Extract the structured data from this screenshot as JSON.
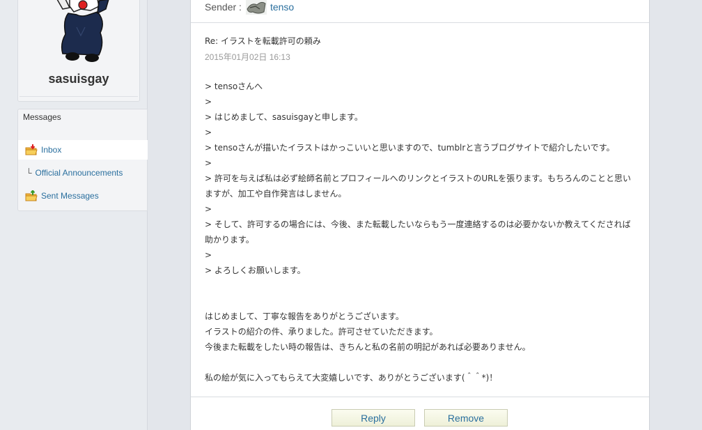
{
  "profile": {
    "username": "sasuisgay"
  },
  "sidebar": {
    "title": "Messages",
    "items": [
      {
        "label": "Inbox",
        "icon": "inbox-folder-icon",
        "active": true
      },
      {
        "label": "Official Announcements",
        "icon": "sub-item-marker",
        "active": false
      },
      {
        "label": "Sent Messages",
        "icon": "sent-folder-icon",
        "active": false
      }
    ]
  },
  "message": {
    "sender_label": "Sender :",
    "sender_name": "tenso",
    "subject": "Re: イラストを転載許可の頼み",
    "date": "2015年01月02日 16:13",
    "body_lines": [
      "> tensoさんへ",
      ">",
      "> はじめまして、sasuisgayと申します。",
      ">",
      "> tensoさんが描いたイラストはかっこいいと思いますので、tumblrと言うブログサイトで紹介したいです。",
      ">",
      "> 許可を与えば私は必ず絵師名前とプロフィールへのリンクとイラストのURLを張ります。もちろんのことと思い",
      "ますが、加工や自作発言はしません。",
      ">",
      "> そして、許可するの場合には、今後、また転載したいならもう一度連絡するのは必要かないか教えてくだされば",
      "助かります。",
      ">",
      "> よろしくお願いします。",
      "",
      "",
      "はじめまして、丁寧な報告をありがとうございます。",
      "イラストの紹介の件、承りました。許可させていただきます。",
      "今後また転載をしたい時の報告は、きちんと私の名前の明記があれば必要ありません。",
      "",
      "私の絵が気に入ってもらえて大変嬉しいです、ありがとうございます(＾＾*)！"
    ]
  },
  "actions": {
    "reply_label": "Reply",
    "remove_label": "Remove"
  },
  "colors": {
    "link": "#2a6f9e",
    "background": "#e3e6eb",
    "button_bg": "#f3f5e2"
  }
}
